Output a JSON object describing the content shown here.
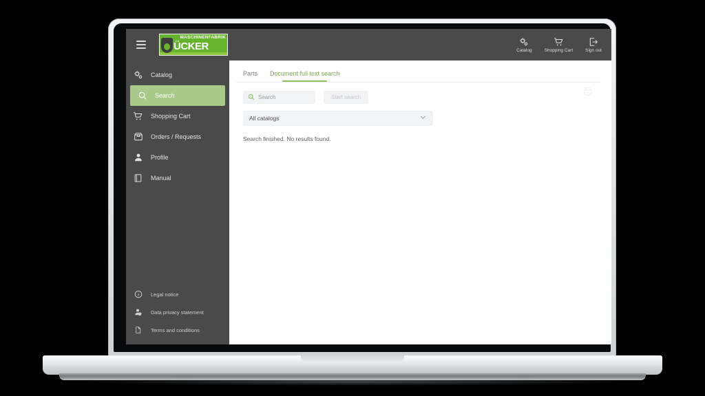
{
  "brand": {
    "logo_top_text": "MASCHINENFABRIK",
    "logo_word": "ÜCKER",
    "logo_letter": "D",
    "green": "#66b32e",
    "accent_green": "#8cbf63",
    "sidebar_dark": "#4a4a4a",
    "active_green": "#a7c98a"
  },
  "topbar": {
    "menu_icon": "hamburger-icon",
    "nav": [
      {
        "label": "Catalog",
        "icon": "gear-catalog-icon"
      },
      {
        "label": "Shopping Cart",
        "icon": "shopping-cart-icon"
      },
      {
        "label": "Sign out",
        "icon": "sign-out-icon"
      }
    ]
  },
  "sidebar": {
    "items": [
      {
        "label": "Catalog",
        "icon": "gear-catalog-icon",
        "active": false
      },
      {
        "label": "Search",
        "icon": "search-icon",
        "active": true
      },
      {
        "label": "Shopping Cart",
        "icon": "shopping-cart-icon",
        "active": false
      },
      {
        "label": "Orders / Requests",
        "icon": "orders-box-icon",
        "active": false
      },
      {
        "label": "Profile",
        "icon": "person-icon",
        "active": false
      },
      {
        "label": "Manual",
        "icon": "manual-book-icon",
        "active": false
      }
    ],
    "footer": [
      {
        "label": "Legal notice",
        "icon": "info-circle-icon"
      },
      {
        "label": "Data privacy statement",
        "icon": "person-shield-icon"
      },
      {
        "label": "Terms and conditions",
        "icon": "document-icon"
      }
    ]
  },
  "main": {
    "tabs": [
      {
        "label": "Parts",
        "active": false
      },
      {
        "label": "Document full text search",
        "active": true
      }
    ],
    "search": {
      "value": "",
      "placeholder": "Search",
      "icon": "search-icon",
      "start_button_label": "Start search",
      "start_button_disabled": true
    },
    "catalog_select": {
      "value": "All catalogs",
      "chevron": "chevron-down-icon"
    },
    "status_text": "Search finished. No results found."
  }
}
